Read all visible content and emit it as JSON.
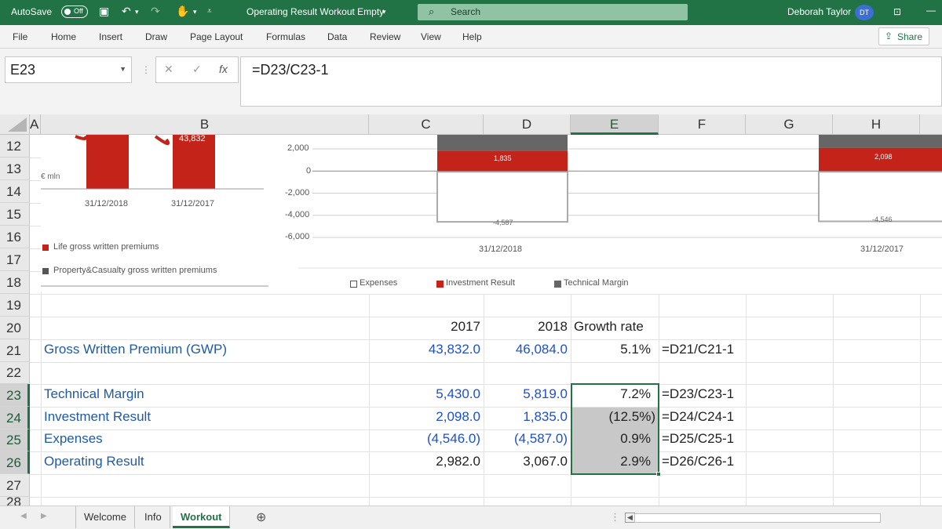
{
  "titlebar": {
    "autosave_label": "AutoSave",
    "autosave_state": "Off",
    "doc_title": "Operating Result Workout Empty",
    "search_placeholder": "Search",
    "user_name": "Deborah Taylor",
    "user_initials": "DT"
  },
  "ribbon": {
    "tabs": [
      "File",
      "Home",
      "Insert",
      "Draw",
      "Page Layout",
      "Formulas",
      "Data",
      "Review",
      "View",
      "Help"
    ],
    "share_label": "Share"
  },
  "formula_bar": {
    "name_box": "E23",
    "formula": "=D23/C23-1"
  },
  "columns": [
    "A",
    "B",
    "C",
    "D",
    "E",
    "F",
    "G",
    "H"
  ],
  "rows": [
    "12",
    "13",
    "14",
    "15",
    "16",
    "17",
    "18",
    "19",
    "20",
    "21",
    "22",
    "23",
    "24",
    "25",
    "26",
    "27",
    "28"
  ],
  "table": {
    "header": {
      "c": "2017",
      "d": "2018",
      "e": "Growth rate"
    },
    "rows": [
      {
        "row": "21",
        "label": "Gross Written Premium (GWP)",
        "c": "43,832.0",
        "d": "46,084.0",
        "e": "5.1%",
        "f": "=D21/C21-1"
      },
      {
        "row": "23",
        "label": "Technical Margin",
        "c": "5,430.0",
        "d": "5,819.0",
        "e": "7.2%",
        "f": "=D23/C23-1"
      },
      {
        "row": "24",
        "label": "Investment Result",
        "c": "2,098.0",
        "d": "1,835.0",
        "e": "(12.5%)",
        "f": "=D24/C24-1"
      },
      {
        "row": "25",
        "label": "Expenses",
        "c": "(4,546.0)",
        "d": "(4,587.0)",
        "e": "0.9%",
        "f": "=D25/C25-1"
      },
      {
        "row": "26",
        "label": "Operating Result",
        "c": "2,982.0",
        "d": "3,067.0",
        "e": "2.9%",
        "f": "=D26/C26-1"
      }
    ]
  },
  "chart_data": [
    {
      "type": "bar",
      "categories": [
        "31/12/2018",
        "31/12/2017"
      ],
      "series": [
        {
          "name": "Life gross written premiums",
          "values": [
            46084,
            43832
          ]
        }
      ],
      "visible_data_labels": [
        "43,832"
      ],
      "ylabel": "€ mln",
      "legend": [
        "Life gross written premiums",
        "Property&Casualty gross written premiums"
      ],
      "legend_placement": "bottom",
      "colors": {
        "life": "#c4231a",
        "pc": "#555555"
      }
    },
    {
      "type": "bar",
      "categories": [
        "31/12/2018",
        "31/12/2017"
      ],
      "yticks": [
        "2,000",
        "0",
        "-2,000",
        "-4,000",
        "-6,000"
      ],
      "ylim": [
        -6000,
        2000
      ],
      "series": [
        {
          "name": "Expenses",
          "values": [
            -4587,
            -4546
          ],
          "labels": [
            "-4,587",
            "-4,546"
          ]
        },
        {
          "name": "Investment Result",
          "values": [
            1835,
            2098
          ],
          "labels": [
            "1,835",
            "2,098"
          ]
        },
        {
          "name": "Technical Margin",
          "values": [
            5819,
            5430
          ]
        }
      ],
      "legend": [
        "Expenses",
        "Investment Result",
        "Technical Margin"
      ],
      "legend_placement": "bottom",
      "colors": {
        "expenses": "#ffffff",
        "investment": "#c4231a",
        "technical": "#666666"
      }
    }
  ],
  "sheet_tabs": [
    "Welcome",
    "Info",
    "Workout"
  ],
  "active_sheet": "Workout"
}
